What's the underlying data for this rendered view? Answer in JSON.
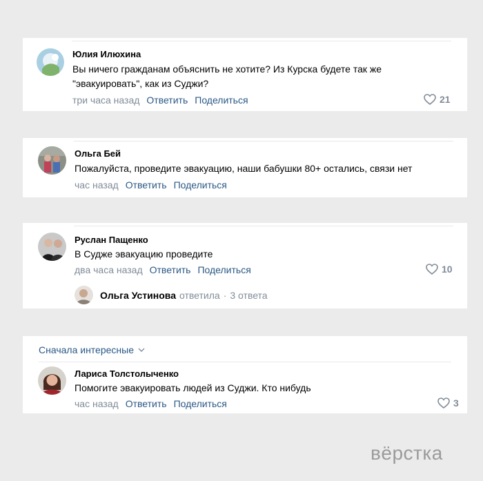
{
  "comments": [
    {
      "author": "Юлия Илюхина",
      "text_line1": "Вы ничего гражданам объяснить не хотите? Из Курска будете так же",
      "text_line2": "\"эвакуировать\", как из Суджи?",
      "time": "три часа назад",
      "reply_label": "Ответить",
      "share_label": "Поделиться",
      "likes": "21"
    },
    {
      "author": "Ольга Бей",
      "text": "Пожалуйста, проведите эвакуацию, наши бабушки 80+ остались, связи нет",
      "time": "час назад",
      "reply_label": "Ответить",
      "share_label": "Поделиться"
    },
    {
      "author": "Руслан Пащенко",
      "text": "В Судже эвакуацию проведите",
      "time": "два часа назад",
      "reply_label": "Ответить",
      "share_label": "Поделиться",
      "likes": "10",
      "reply_thread": {
        "name": "Ольга Устинова",
        "verb": "ответила",
        "separator": "·",
        "count": "3 ответа"
      }
    },
    {
      "author": "Лариса Толстолыченко",
      "text": "Помогите эвакуировать людей из Суджи. Кто нибудь",
      "time": "час назад",
      "reply_label": "Ответить",
      "share_label": "Поделиться",
      "likes": "3"
    }
  ],
  "sort": {
    "label": "Сначала интересные",
    "icon": "chevron-down-icon"
  },
  "watermark": "вёрстка",
  "colors": {
    "background": "#ebebeb",
    "link": "#2a5885",
    "meta": "#818c99",
    "card": "#ffffff"
  }
}
